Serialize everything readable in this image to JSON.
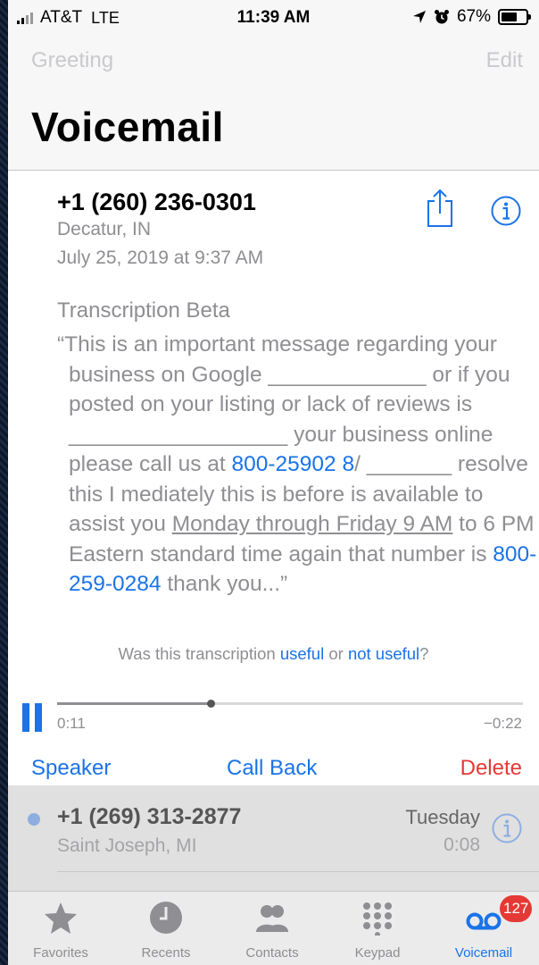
{
  "status_bar": {
    "carrier": "AT&T",
    "network": "LTE",
    "time": "11:39 AM",
    "battery_percent": "67%",
    "battery_level": 0.67
  },
  "nav": {
    "left_label": "Greeting",
    "right_label": "Edit",
    "title": "Voicemail"
  },
  "selected_voicemail": {
    "caller": "+1 (260) 236-0301",
    "location": "Decatur, IN",
    "datetime": "July 25, 2019 at 9:37 AM",
    "transcription_label": "Transcription Beta",
    "transcript": {
      "part1": "“This is an important message regarding your business on Google _____________ or if you posted on your listing or lack of reviews is __________________ your business online please call us at ",
      "link1": "800-25902 8",
      "part2": "/ _______ resolve this I mediately this is before is available to assist you ",
      "underlined": "Monday through Friday 9 AM",
      "part3": " to 6 PM Eastern standard time again that number is ",
      "link2": "800-259-0284",
      "part4": " thank you...”"
    },
    "feedback": {
      "prefix": "Was this transcription ",
      "useful": "useful",
      "middle": " or ",
      "not_useful": "not useful",
      "suffix": "?"
    },
    "player": {
      "elapsed": "0:11",
      "remaining": "−0:22",
      "progress": 0.33
    },
    "actions": {
      "speaker": "Speaker",
      "call_back": "Call Back",
      "delete": "Delete"
    }
  },
  "voicemail_list": [
    {
      "caller": "+1 (269) 313-2877",
      "location": "Saint Joseph, MI",
      "day": "Tuesday",
      "duration": "0:08",
      "unread": true
    }
  ],
  "tab_bar": {
    "tabs": [
      {
        "label": "Favorites",
        "icon": "star-icon"
      },
      {
        "label": "Recents",
        "icon": "clock-icon"
      },
      {
        "label": "Contacts",
        "icon": "contacts-icon"
      },
      {
        "label": "Keypad",
        "icon": "keypad-icon"
      },
      {
        "label": "Voicemail",
        "icon": "voicemail-icon",
        "badge": "127",
        "active": true
      }
    ]
  },
  "colors": {
    "accent": "#1a73e8",
    "destructive": "#e53935",
    "secondary_text": "#8e8e93"
  }
}
